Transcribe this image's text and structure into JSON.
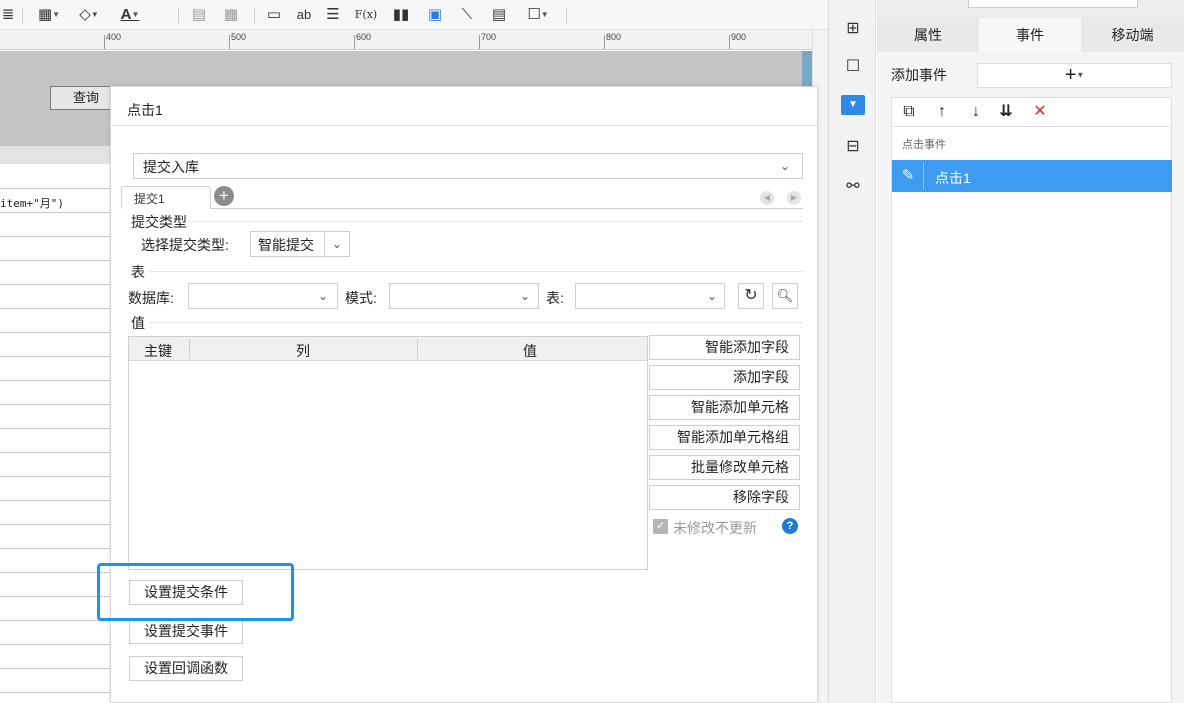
{
  "toolbar": {
    "icons": [
      "list-icon",
      "border-icon",
      "fill-color-icon",
      "font-color-icon",
      "table-icon",
      "grid-icon",
      "textfield-icon",
      "label-icon",
      "align-icon",
      "formula-icon",
      "bar-chart-icon",
      "image-icon",
      "line-icon",
      "page-icon",
      "frame-icon"
    ],
    "text_icon": "ab",
    "font_color_glyph": "A",
    "formula_glyph": "F(x)"
  },
  "ruler": {
    "labels": [
      "400",
      "500",
      "600",
      "700",
      "800",
      "900"
    ]
  },
  "canvas": {
    "query_button": "查询"
  },
  "sheet": {
    "formula_text": "item+\"月\")"
  },
  "right_panel": {
    "tabs": [
      "属性",
      "事件",
      "移动端"
    ],
    "active_tab": 1,
    "add_event_label": "添加事件",
    "add_symbol": "+",
    "list_header": "点击事件",
    "selected_item": "点击1"
  },
  "dialog": {
    "title": "点击1",
    "operation": "提交入库",
    "tab_label": "提交1",
    "section_submit_type": "提交类型",
    "select_type_label": "选择提交类型:",
    "select_type_value": "智能提交",
    "section_table": "表",
    "db_label": "数据库:",
    "schema_label": "模式:",
    "table_label": "表:",
    "section_value": "值",
    "columns": [
      "主键",
      "列",
      "值"
    ],
    "side_buttons": [
      "智能添加字段",
      "添加字段",
      "智能添加单元格",
      "智能添加单元格组",
      "批量修改单元格",
      "移除字段"
    ],
    "no_update_checkbox": "未修改不更新",
    "bottom_buttons": [
      "设置提交条件",
      "设置提交事件",
      "设置回调函数"
    ]
  },
  "colors": {
    "accent": "#3d9cf0",
    "highlight": "#1595f0",
    "delete": "#e0302e"
  }
}
